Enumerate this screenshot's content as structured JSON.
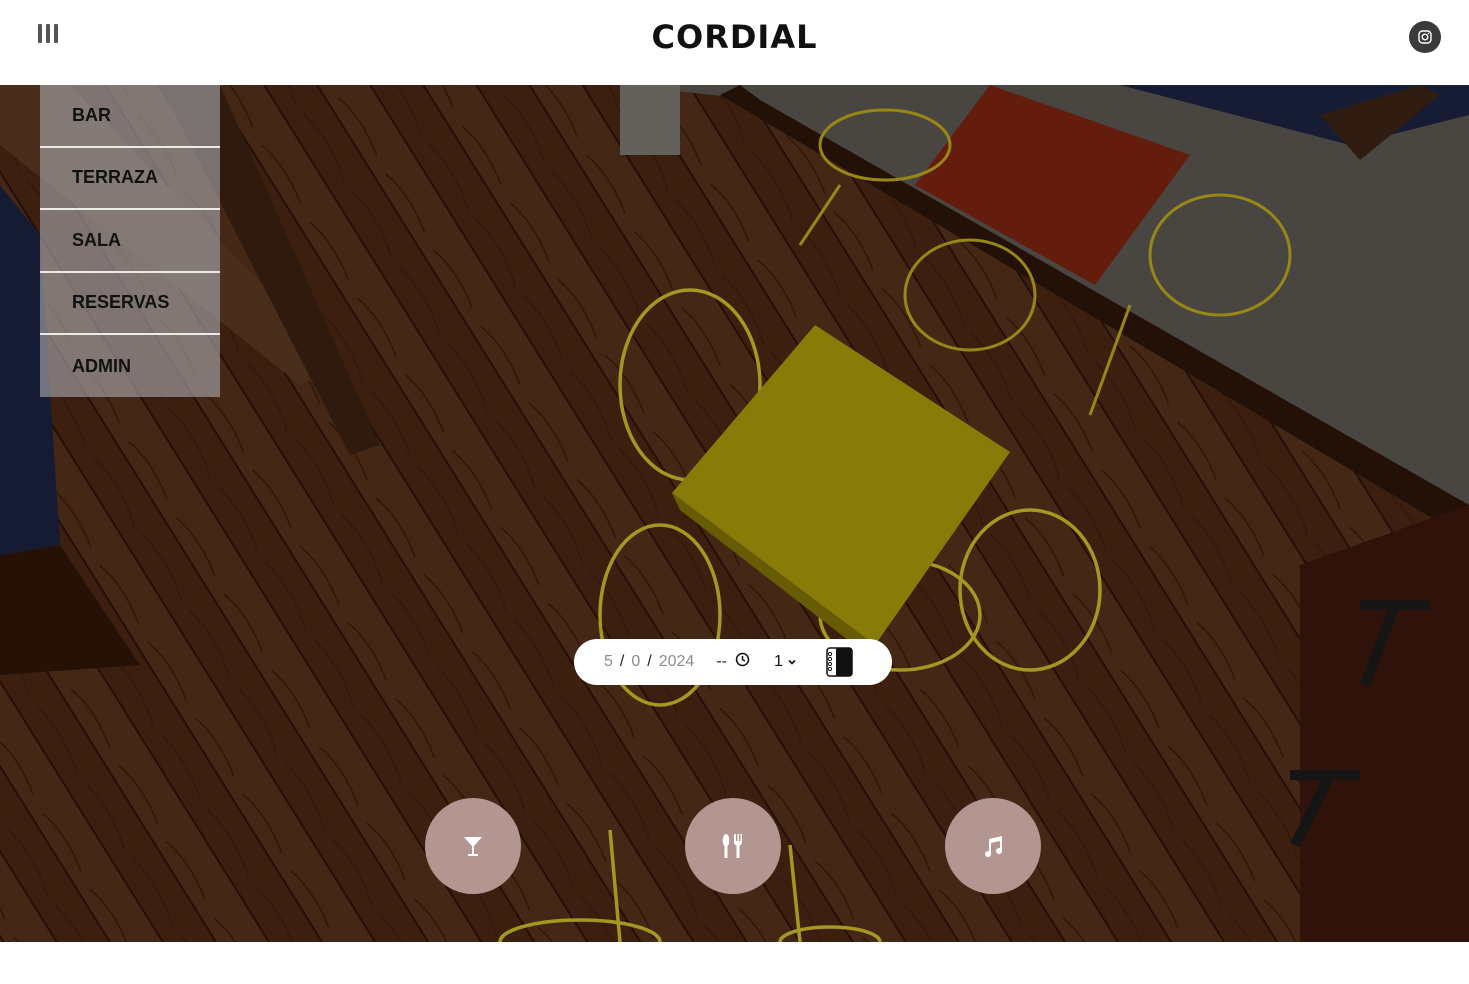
{
  "header": {
    "brand": "CORDIAL",
    "menu_icon": "menu-bars-icon",
    "social_icon": "instagram-icon"
  },
  "nav": {
    "items": [
      {
        "label": "BAR"
      },
      {
        "label": "TERRAZA"
      },
      {
        "label": "SALA"
      },
      {
        "label": "RESERVAS"
      },
      {
        "label": "ADMIN"
      }
    ]
  },
  "booking": {
    "day": "5",
    "month": "0",
    "year": "2024",
    "date_separator": "/",
    "time": "--",
    "guests": "1",
    "clock_icon": "clock-icon",
    "dropdown_icon": "chevron-down-icon",
    "submit_icon": "reservation-book-icon"
  },
  "actions": [
    {
      "icon": "cocktail-glass-icon"
    },
    {
      "icon": "fork-knife-icon"
    },
    {
      "icon": "music-note-icon"
    }
  ],
  "colors": {
    "action_button": "#b39591",
    "nav_overlay": "#aaaaaf",
    "table_yellow": "#a8960a",
    "chair_yellow": "#c9b92a"
  }
}
